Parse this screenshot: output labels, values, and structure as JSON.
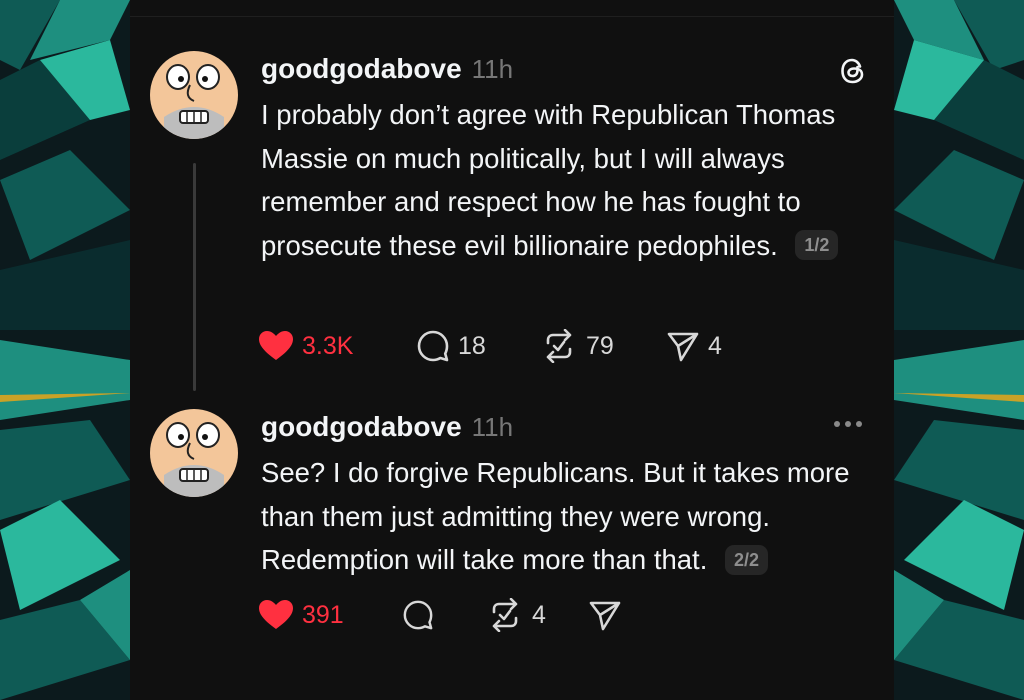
{
  "backdrop": {
    "colors": [
      "#0c1a1d",
      "#0f5b55",
      "#1e8f7f",
      "#2bb89d"
    ]
  },
  "posts": [
    {
      "username": "goodgodabove",
      "time": "11h",
      "text": "I probably don’t agree with Republican Thomas Massie on much politically, but I will always remember and respect how he has fought to prosecute these evil billionaire pedophiles.",
      "pager": "1/2",
      "top_icon": "threads-logo-icon",
      "likes": "3.3K",
      "replies": "18",
      "reposts": "79",
      "shares": "4"
    },
    {
      "username": "goodgodabove",
      "time": "11h",
      "text": "See? I do forgive Republicans. But it takes more than them just admitting they were wrong. Redemption will take more than that.",
      "pager": "2/2",
      "top_icon": "more-options-icon",
      "likes": "391",
      "replies": "",
      "reposts": "4",
      "shares": ""
    }
  ],
  "colors": {
    "like": "#ff3040",
    "text": "#f3f5f7",
    "muted": "#777777",
    "card": "#101010"
  }
}
